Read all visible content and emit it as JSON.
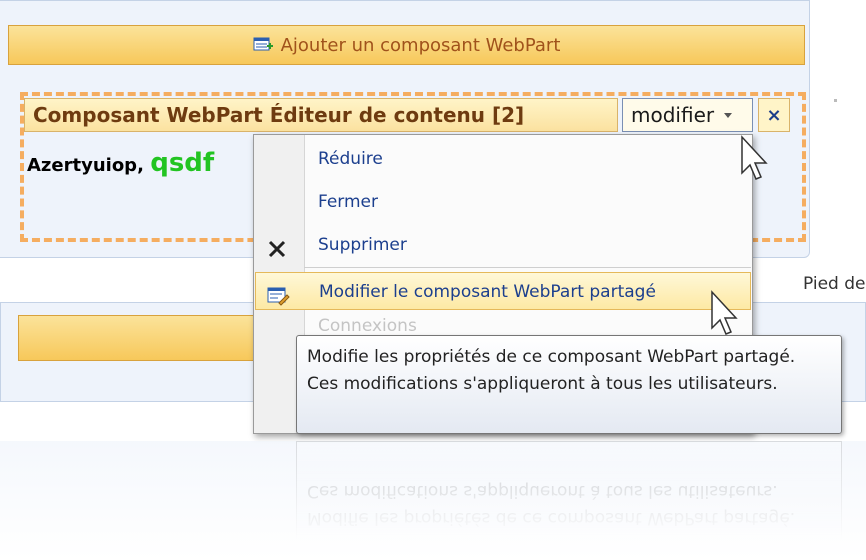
{
  "zone_top": {
    "add_webpart_label": "Ajouter un composant WebPart"
  },
  "webpart": {
    "title": "Composant WebPart Éditeur de contenu [2]",
    "modifier_label": "modifier",
    "close_glyph": "×",
    "content_black": "Azertyuiop",
    "content_separator": ",",
    "content_green": "qsdf"
  },
  "footer_text": "Pied de",
  "menu": {
    "items": [
      {
        "label": "Réduire",
        "icon": ""
      },
      {
        "label": "Fermer",
        "icon": ""
      },
      {
        "label": "Supprimer",
        "icon": "delete-x-icon"
      },
      {
        "label": "Modifier le composant WebPart partagé",
        "icon": "edit-webpart-icon"
      },
      {
        "label": "Connexions",
        "icon": ""
      }
    ]
  },
  "tooltip": {
    "text": "Modifie les propriétés de ce composant WebPart partagé. Ces modifications s'appliqueront à tous les utilisateurs."
  },
  "colors": {
    "zone_bg": "#eef3fb",
    "orange_bar": "#f7c85a",
    "dashed_border": "#f5ad60",
    "menu_text": "#1c3f8e",
    "green_text": "#22c422"
  }
}
